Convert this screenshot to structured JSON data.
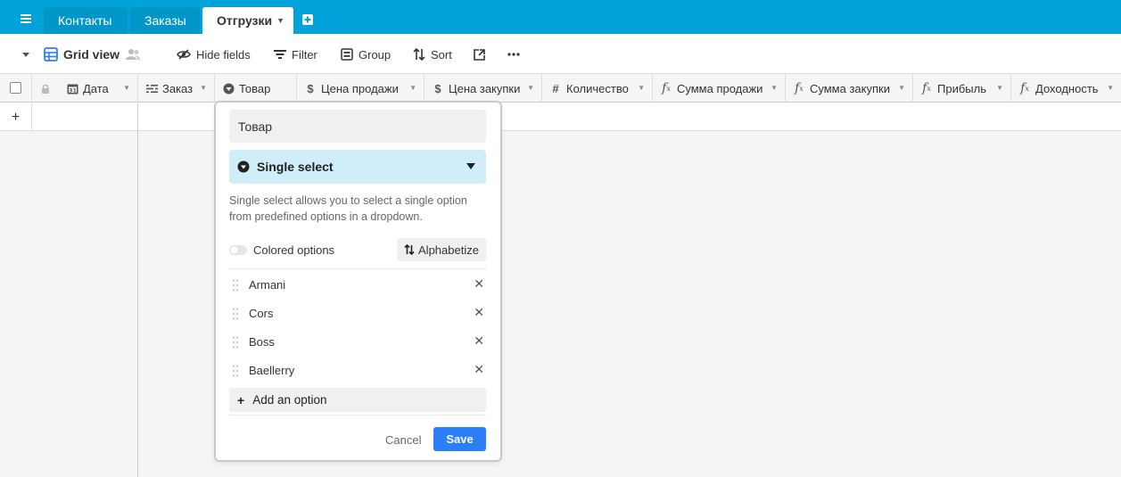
{
  "tabs": [
    {
      "label": "Контакты",
      "active": false
    },
    {
      "label": "Заказы",
      "active": false
    },
    {
      "label": "Отгрузки",
      "active": true
    }
  ],
  "toolbar": {
    "view_name": "Grid view",
    "hide_fields": "Hide fields",
    "filter": "Filter",
    "group": "Group",
    "sort": "Sort"
  },
  "columns": [
    {
      "label": "Дата",
      "icon": "calendar-icon"
    },
    {
      "label": "Заказ",
      "icon": "link-icon"
    },
    {
      "label": "Товар",
      "icon": "single-select-icon"
    },
    {
      "label": "Цена продажи",
      "icon": "currency-icon"
    },
    {
      "label": "Цена закупки",
      "icon": "currency-icon"
    },
    {
      "label": "Количество",
      "icon": "number-icon"
    },
    {
      "label": "Сумма продажи",
      "icon": "formula-icon"
    },
    {
      "label": "Сумма закупки",
      "icon": "formula-icon"
    },
    {
      "label": "Прибыль",
      "icon": "formula-icon"
    },
    {
      "label": "Доходность",
      "icon": "formula-icon"
    }
  ],
  "popup": {
    "field_name": "Товар",
    "field_type": "Single select",
    "description": "Single select allows you to select a single option from predefined options in a dropdown.",
    "colored_options_label": "Colored options",
    "alphabetize_label": "Alphabetize",
    "options": [
      "Armani",
      "Cors",
      "Boss",
      "Baellerry"
    ],
    "add_option_label": "Add an option",
    "cancel_label": "Cancel",
    "save_label": "Save"
  },
  "colors": {
    "tabbar": "#00a3d9",
    "type_select_bg": "#d0eefa",
    "save_button": "#2d7ff9"
  }
}
